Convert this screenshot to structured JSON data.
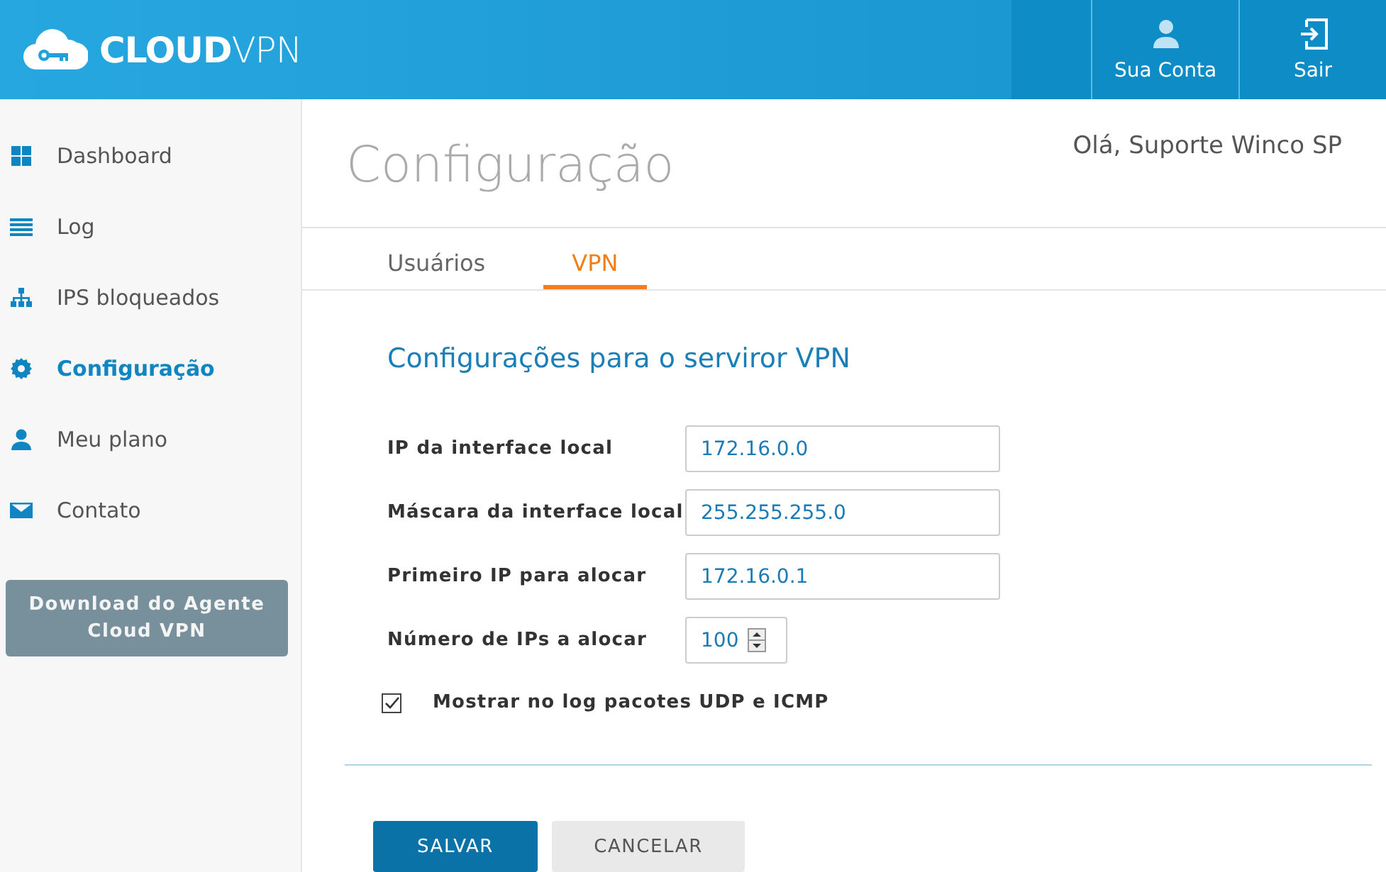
{
  "header": {
    "logo": "**CLOUD**VPN",
    "actions": [
      {
        "kind": "account",
        "label": "Sua Conta"
      },
      {
        "kind": "exit",
        "label": "Sair"
      }
    ]
  },
  "sidebar": {
    "items": [
      {
        "kind": "dashboard",
        "label": "Dashboard",
        "selected": false
      },
      {
        "kind": "log",
        "label": "Log",
        "selected": false
      },
      {
        "kind": "network",
        "label": "IPS bloqueados",
        "selected": false
      },
      {
        "kind": "settings",
        "label": "Configuração",
        "selected": true
      },
      {
        "kind": "user",
        "label": "Meu plano",
        "selected": false
      },
      {
        "kind": "mail",
        "label": "Contato",
        "selected": false
      }
    ],
    "download_button": "Download do Agente Cloud VPN"
  },
  "page": {
    "title": "Configuração",
    "greeting": "Olá, Suporte Winco SP"
  },
  "tabs": [
    {
      "label": "Usuários",
      "selected": false
    },
    {
      "label": "VPN",
      "selected": true
    }
  ],
  "form": {
    "heading": "Configurações para o serviror VPN",
    "fields": [
      {
        "kind": "text",
        "label": "IP da interface local",
        "value": "172.16.0.0"
      },
      {
        "kind": "text",
        "label": "Máscara da interface local",
        "value": "255.255.255.0"
      },
      {
        "kind": "text",
        "label": "Primeiro IP para alocar",
        "value": "172.16.0.1"
      },
      {
        "kind": "number",
        "label": "Número de IPs a alocar",
        "value": "100"
      }
    ],
    "checkbox": {
      "label": "Mostrar no log pacotes UDP e ICMP",
      "checked": true
    }
  },
  "buttons": [
    {
      "kind": "primary",
      "label": "SALVAR"
    },
    {
      "kind": "secondary",
      "label": "CANCELAR"
    }
  ]
}
